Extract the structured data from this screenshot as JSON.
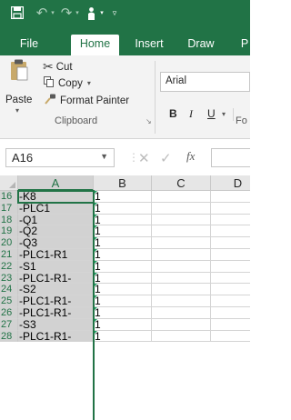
{
  "quick_access": {
    "items": [
      "save-icon",
      "undo-icon",
      "redo-icon",
      "touch-mode-icon",
      "customize-icon"
    ]
  },
  "tabs": [
    {
      "label": "File",
      "active": false
    },
    {
      "label": "Home",
      "active": true
    },
    {
      "label": "Insert",
      "active": false
    },
    {
      "label": "Draw",
      "active": false
    },
    {
      "label": "P",
      "active": false
    }
  ],
  "clipboard": {
    "paste_label": "Paste",
    "cut_label": "Cut",
    "copy_label": "Copy",
    "format_painter_label": "Format Painter",
    "group_label": "Clipboard"
  },
  "font": {
    "font_name": "Arial",
    "bold": "B",
    "italic": "I",
    "underline": "U",
    "group_label": "Fo"
  },
  "formula_bar": {
    "name_box": "A16",
    "fx_label": "fx",
    "formula_value": ""
  },
  "grid": {
    "columns": [
      "A",
      "B",
      "C",
      "D"
    ],
    "selected_column": "A",
    "rows": [
      {
        "num": "16",
        "a": "-K8",
        "b": "1"
      },
      {
        "num": "17",
        "a": "-PLC1",
        "b": "1"
      },
      {
        "num": "18",
        "a": "-Q1",
        "b": "1"
      },
      {
        "num": "19",
        "a": "-Q2",
        "b": "1"
      },
      {
        "num": "20",
        "a": "-Q3",
        "b": "1"
      },
      {
        "num": "21",
        "a": "-PLC1-R1",
        "b": "1"
      },
      {
        "num": "22",
        "a": "-S1",
        "b": "1"
      },
      {
        "num": "23",
        "a": "-PLC1-R1-",
        "b": "1"
      },
      {
        "num": "24",
        "a": "-S2",
        "b": "1"
      },
      {
        "num": "25",
        "a": "-PLC1-R1-",
        "b": "1"
      },
      {
        "num": "26",
        "a": "-PLC1-R1-",
        "b": "1"
      },
      {
        "num": "27",
        "a": "-S3",
        "b": "1"
      },
      {
        "num": "28",
        "a": "-PLC1-R1-",
        "b": "1"
      }
    ]
  },
  "colors": {
    "brand": "#217346",
    "selection_fill": "#d2d2d2",
    "error_indicator": "#21a366"
  }
}
